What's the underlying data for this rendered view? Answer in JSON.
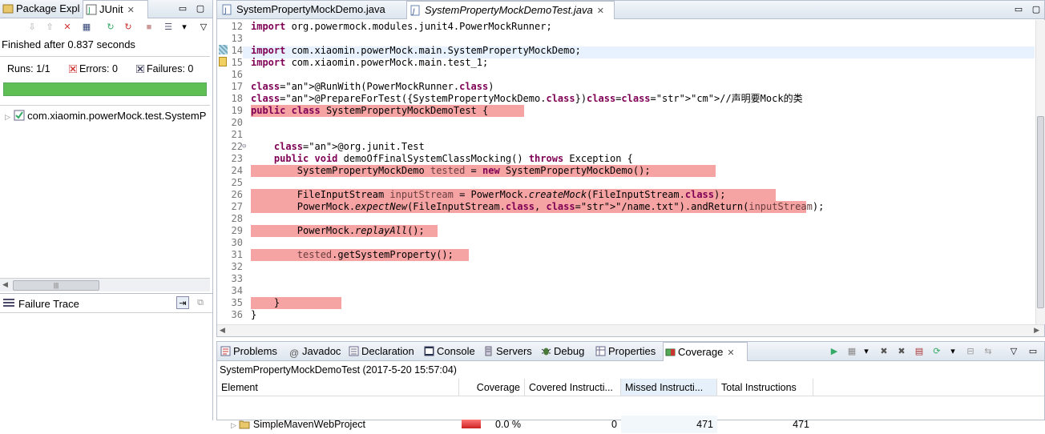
{
  "left_panel": {
    "tabs": [
      {
        "label": "Package Expl"
      },
      {
        "label": "JUnit",
        "close": "✕"
      }
    ],
    "status": "Finished after 0.837 seconds",
    "counters": {
      "runs_label": "Runs:",
      "runs_value": "1/1",
      "errors_label": "Errors:",
      "errors_value": "0",
      "failures_label": "Failures:",
      "failures_value": "0"
    },
    "progress_value": 1.0,
    "progress_color": "#5fbf55",
    "tree": {
      "item": "com.xiaomin.powerMock.test.SystemP"
    },
    "failure_trace_title": "Failure Trace"
  },
  "editor": {
    "tabs": [
      {
        "label": "SystemPropertyMockDemo.java"
      },
      {
        "label": "SystemPropertyMockDemoTest.java",
        "close": "✕"
      }
    ],
    "lines": [
      {
        "n": "12",
        "text": "import org.powermock.modules.junit4.PowerMockRunner;"
      },
      {
        "n": "13",
        "text": ""
      },
      {
        "n": "14",
        "text": "import com.xiaomin.powerMock.main.SystemPropertyMockDemo;"
      },
      {
        "n": "15",
        "text": "import com.xiaomin.powerMock.main.test_1;"
      },
      {
        "n": "16",
        "text": ""
      },
      {
        "n": "17",
        "text": "@RunWith(PowerMockRunner.class)"
      },
      {
        "n": "18",
        "text": "@PrepareForTest({SystemPropertyMockDemo.class})//声明要Mock的类"
      },
      {
        "n": "19",
        "text": "public class SystemPropertyMockDemoTest {"
      },
      {
        "n": "20",
        "text": ""
      },
      {
        "n": "21",
        "text": ""
      },
      {
        "n": "22",
        "text": "    @org.junit.Test"
      },
      {
        "n": "23",
        "text": "    public void demoOfFinalSystemClassMocking() throws Exception {"
      },
      {
        "n": "24",
        "text": "        SystemPropertyMockDemo tested = new SystemPropertyMockDemo();"
      },
      {
        "n": "25",
        "text": ""
      },
      {
        "n": "26",
        "text": "        FileInputStream inputStream = PowerMock.createMock(FileInputStream.class);"
      },
      {
        "n": "27",
        "text": "        PowerMock.expectNew(FileInputStream.class, \"/name.txt\").andReturn(inputStream);"
      },
      {
        "n": "28",
        "text": ""
      },
      {
        "n": "29",
        "text": "        PowerMock.replayAll();"
      },
      {
        "n": "30",
        "text": ""
      },
      {
        "n": "31",
        "text": "        tested.getSystemProperty();"
      },
      {
        "n": "32",
        "text": ""
      },
      {
        "n": "33",
        "text": ""
      },
      {
        "n": "34",
        "text": ""
      },
      {
        "n": "35",
        "text": "    }"
      },
      {
        "n": "36",
        "text": "}"
      }
    ]
  },
  "bottom_panel": {
    "tabs": [
      {
        "label": "Problems"
      },
      {
        "label": "Javadoc"
      },
      {
        "label": "Declaration"
      },
      {
        "label": "Console"
      },
      {
        "label": "Servers"
      },
      {
        "label": "Debug"
      },
      {
        "label": "Properties"
      },
      {
        "label": "Coverage",
        "close": "✕"
      }
    ],
    "session": "SystemPropertyMockDemoTest (2017-5-20 15:57:04)",
    "columns": [
      "Element",
      "Coverage",
      "Covered Instructi...",
      "Missed Instructi...",
      "Total Instructions"
    ],
    "row": {
      "element": "SimpleMavenWebProject",
      "coverage": "0.0 %",
      "covered": "0",
      "missed": "471",
      "total": "471"
    }
  }
}
